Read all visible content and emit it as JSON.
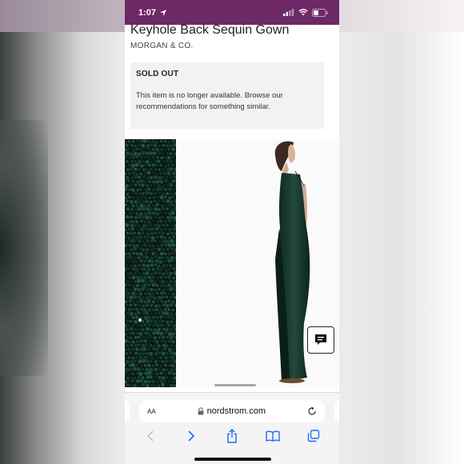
{
  "status": {
    "time": "1:07"
  },
  "product": {
    "title": "Keyhole Back Sequin Gown",
    "brand": "MORGAN & CO."
  },
  "notice": {
    "heading": "SOLD OUT",
    "message": "This item is no longer available. Browse our recommendations for something similar."
  },
  "browser": {
    "text_size_label": "AA",
    "url": "nordstrom.com"
  },
  "colors": {
    "status_bar": "#6d2866",
    "sequin": "#12352a",
    "notice_bg": "#f2f2f2",
    "toolbar_blue": "#1a6ff2"
  },
  "icons": [
    "location-arrow-icon",
    "signal-icon",
    "wifi-icon",
    "battery-icon",
    "chat-icon",
    "lock-icon",
    "reload-icon",
    "back-icon",
    "forward-icon",
    "share-icon",
    "bookmarks-icon",
    "tabs-icon"
  ]
}
